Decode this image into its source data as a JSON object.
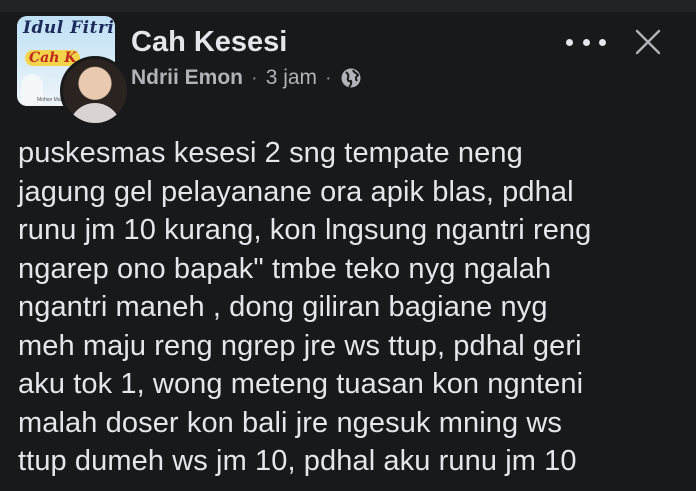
{
  "group": {
    "name": "Cah Kesesi",
    "avatar_title": "Idul Fitri",
    "avatar_subtitle": "Cah K",
    "avatar_footer": "Mohon Maaf"
  },
  "post": {
    "author": "Ndrii Emon",
    "separator": "·",
    "time": "3 jam",
    "privacy_icon": "globe-icon",
    "text": "puskesmas kesesi 2 sng tempate neng\njagung gel pelayanane ora apik blas, pdhal\nrunu jm 10 kurang, kon lngsung ngantri reng\nngarep ono bapak\" tmbe teko nyg ngalah\nngantri maneh , dong giliran bagiane nyg\nmeh maju reng ngrep jre ws ttup, pdhal geri\naku tok 1, wong meteng tuasan kon ngnteni\nmalah doser kon bali jre ngesuk mning ws\nttup dumeh ws jm 10, pdhal aku runu jm 10"
  },
  "actions": {
    "more_icon": "more-dots-icon",
    "close_icon": "close-icon"
  },
  "colors": {
    "background": "#18191a",
    "primary_text": "#e4e6eb",
    "secondary_text": "#b0b3b8"
  }
}
